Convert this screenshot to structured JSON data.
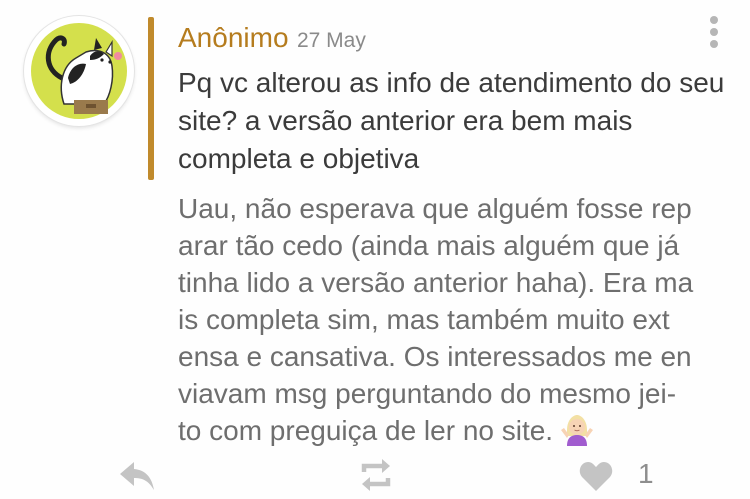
{
  "comment": {
    "author": "Anônimo",
    "date": "27 May",
    "question": "Pq vc alterou as info de atendimento do seu site? a versão anterior era bem mais completa e objetiva",
    "answer": "Uau, não esperava que alguém fosse rep\narar tão cedo (ainda mais alguém que já\ntinha lido a versão anterior haha). Era ma\nis completa sim, mas também muito ext\nensa e cansativa. Os interessados me en\nviavam msg perguntando do mesmo jei-\nto com preguiça de ler no site.",
    "answer_emoji": "woman-shrugging-icon"
  },
  "actions": {
    "reply_icon": "reply-icon",
    "repost_icon": "repost-icon",
    "like_icon": "heart-icon",
    "like_count": "1",
    "more_icon": "vertical-dots-icon"
  },
  "colors": {
    "accent": "#b57c1e",
    "quote_bar": "#c08a2c",
    "avatar_bg": "#d4e04c",
    "icon_gray": "#c4c4c4"
  }
}
